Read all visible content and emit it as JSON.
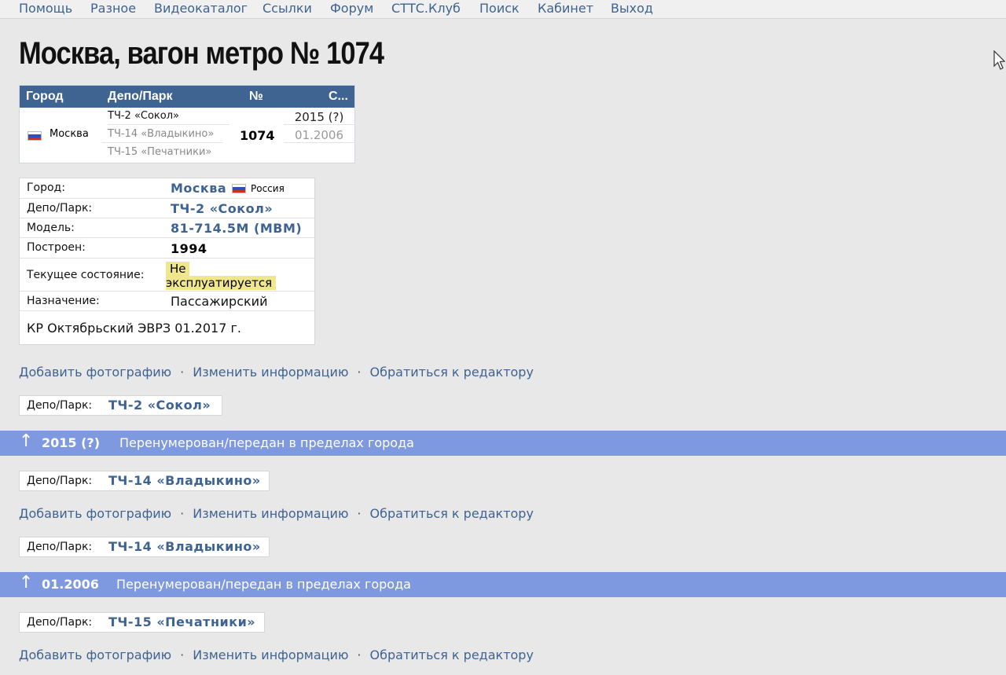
{
  "nav": [
    "Помощь",
    "Разное",
    "Видеокаталог",
    "Ссылки",
    "Форум",
    "СТТС.Клуб",
    "Поиск",
    "Кабинет",
    "Выход"
  ],
  "title": "Москва, вагон метро № 1074",
  "vtable": {
    "headers": [
      "Город",
      "Депо/Парк",
      "№",
      "С..."
    ],
    "city": "Москва",
    "depots": [
      "ТЧ-2 «Сокол»",
      "ТЧ-14 «Владыкино»",
      "ТЧ-15 «Печатники»"
    ],
    "number": "1074",
    "dates": [
      "2015 (?)",
      "01.2006"
    ]
  },
  "info": {
    "city_label": "Город:",
    "city_value": "Москва",
    "country": "Россия",
    "depot_label": "Депо/Парк:",
    "depot_value": "ТЧ-2 «Сокол»",
    "model_label": "Модель:",
    "model_value": "81-714.5М (МВМ)",
    "built_label": "Построен:",
    "built_value": "1994",
    "state_label": "Текущее состояние:",
    "state_value_1": "Не",
    "state_value_2": "эксплуатируется",
    "purpose_label": "Назначение:",
    "purpose_value": "Пассажирский",
    "note": "КР Октябрьский ЭВРЗ 01.2017 г."
  },
  "actions": {
    "add_photo": "Добавить фотографию",
    "edit_info": "Изменить информацию",
    "contact_editor": "Обратиться к редактору",
    "separator": "·"
  },
  "history": {
    "depot_label": "Депо/Парк:",
    "block1_depot": "ТЧ-2 «Сокол»",
    "band1_year": "2015 (?)",
    "band1_text": "Перенумерован/передан в пределах города",
    "block2_depot": "ТЧ-14 «Владыкино»",
    "block3_depot": "ТЧ-14 «Владыкино»",
    "band2_year": "01.2006",
    "band2_text": "Перенумерован/передан в пределах города",
    "block4_depot": "ТЧ-15 «Печатники»",
    "arrow": "↑"
  }
}
